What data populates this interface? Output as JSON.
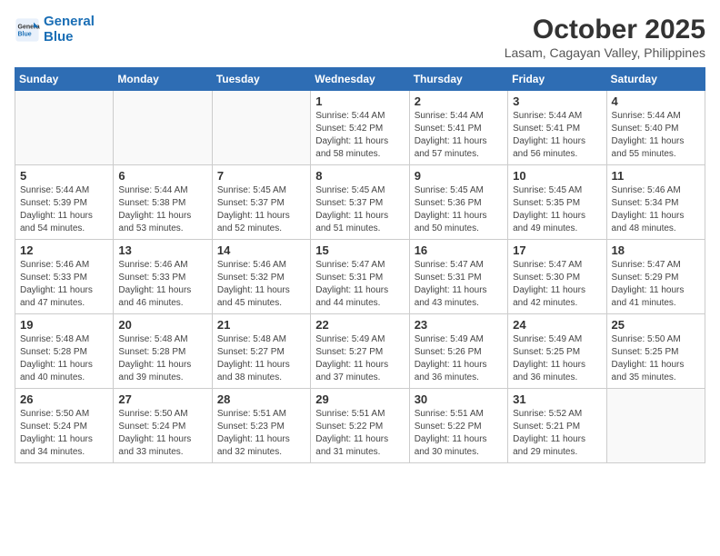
{
  "logo": {
    "line1": "General",
    "line2": "Blue"
  },
  "title": "October 2025",
  "subtitle": "Lasam, Cagayan Valley, Philippines",
  "days_of_week": [
    "Sunday",
    "Monday",
    "Tuesday",
    "Wednesday",
    "Thursday",
    "Friday",
    "Saturday"
  ],
  "weeks": [
    [
      {
        "day": "",
        "info": ""
      },
      {
        "day": "",
        "info": ""
      },
      {
        "day": "",
        "info": ""
      },
      {
        "day": "1",
        "info": "Sunrise: 5:44 AM\nSunset: 5:42 PM\nDaylight: 11 hours\nand 58 minutes."
      },
      {
        "day": "2",
        "info": "Sunrise: 5:44 AM\nSunset: 5:41 PM\nDaylight: 11 hours\nand 57 minutes."
      },
      {
        "day": "3",
        "info": "Sunrise: 5:44 AM\nSunset: 5:41 PM\nDaylight: 11 hours\nand 56 minutes."
      },
      {
        "day": "4",
        "info": "Sunrise: 5:44 AM\nSunset: 5:40 PM\nDaylight: 11 hours\nand 55 minutes."
      }
    ],
    [
      {
        "day": "5",
        "info": "Sunrise: 5:44 AM\nSunset: 5:39 PM\nDaylight: 11 hours\nand 54 minutes."
      },
      {
        "day": "6",
        "info": "Sunrise: 5:44 AM\nSunset: 5:38 PM\nDaylight: 11 hours\nand 53 minutes."
      },
      {
        "day": "7",
        "info": "Sunrise: 5:45 AM\nSunset: 5:37 PM\nDaylight: 11 hours\nand 52 minutes."
      },
      {
        "day": "8",
        "info": "Sunrise: 5:45 AM\nSunset: 5:37 PM\nDaylight: 11 hours\nand 51 minutes."
      },
      {
        "day": "9",
        "info": "Sunrise: 5:45 AM\nSunset: 5:36 PM\nDaylight: 11 hours\nand 50 minutes."
      },
      {
        "day": "10",
        "info": "Sunrise: 5:45 AM\nSunset: 5:35 PM\nDaylight: 11 hours\nand 49 minutes."
      },
      {
        "day": "11",
        "info": "Sunrise: 5:46 AM\nSunset: 5:34 PM\nDaylight: 11 hours\nand 48 minutes."
      }
    ],
    [
      {
        "day": "12",
        "info": "Sunrise: 5:46 AM\nSunset: 5:33 PM\nDaylight: 11 hours\nand 47 minutes."
      },
      {
        "day": "13",
        "info": "Sunrise: 5:46 AM\nSunset: 5:33 PM\nDaylight: 11 hours\nand 46 minutes."
      },
      {
        "day": "14",
        "info": "Sunrise: 5:46 AM\nSunset: 5:32 PM\nDaylight: 11 hours\nand 45 minutes."
      },
      {
        "day": "15",
        "info": "Sunrise: 5:47 AM\nSunset: 5:31 PM\nDaylight: 11 hours\nand 44 minutes."
      },
      {
        "day": "16",
        "info": "Sunrise: 5:47 AM\nSunset: 5:31 PM\nDaylight: 11 hours\nand 43 minutes."
      },
      {
        "day": "17",
        "info": "Sunrise: 5:47 AM\nSunset: 5:30 PM\nDaylight: 11 hours\nand 42 minutes."
      },
      {
        "day": "18",
        "info": "Sunrise: 5:47 AM\nSunset: 5:29 PM\nDaylight: 11 hours\nand 41 minutes."
      }
    ],
    [
      {
        "day": "19",
        "info": "Sunrise: 5:48 AM\nSunset: 5:28 PM\nDaylight: 11 hours\nand 40 minutes."
      },
      {
        "day": "20",
        "info": "Sunrise: 5:48 AM\nSunset: 5:28 PM\nDaylight: 11 hours\nand 39 minutes."
      },
      {
        "day": "21",
        "info": "Sunrise: 5:48 AM\nSunset: 5:27 PM\nDaylight: 11 hours\nand 38 minutes."
      },
      {
        "day": "22",
        "info": "Sunrise: 5:49 AM\nSunset: 5:27 PM\nDaylight: 11 hours\nand 37 minutes."
      },
      {
        "day": "23",
        "info": "Sunrise: 5:49 AM\nSunset: 5:26 PM\nDaylight: 11 hours\nand 36 minutes."
      },
      {
        "day": "24",
        "info": "Sunrise: 5:49 AM\nSunset: 5:25 PM\nDaylight: 11 hours\nand 36 minutes."
      },
      {
        "day": "25",
        "info": "Sunrise: 5:50 AM\nSunset: 5:25 PM\nDaylight: 11 hours\nand 35 minutes."
      }
    ],
    [
      {
        "day": "26",
        "info": "Sunrise: 5:50 AM\nSunset: 5:24 PM\nDaylight: 11 hours\nand 34 minutes."
      },
      {
        "day": "27",
        "info": "Sunrise: 5:50 AM\nSunset: 5:24 PM\nDaylight: 11 hours\nand 33 minutes."
      },
      {
        "day": "28",
        "info": "Sunrise: 5:51 AM\nSunset: 5:23 PM\nDaylight: 11 hours\nand 32 minutes."
      },
      {
        "day": "29",
        "info": "Sunrise: 5:51 AM\nSunset: 5:22 PM\nDaylight: 11 hours\nand 31 minutes."
      },
      {
        "day": "30",
        "info": "Sunrise: 5:51 AM\nSunset: 5:22 PM\nDaylight: 11 hours\nand 30 minutes."
      },
      {
        "day": "31",
        "info": "Sunrise: 5:52 AM\nSunset: 5:21 PM\nDaylight: 11 hours\nand 29 minutes."
      },
      {
        "day": "",
        "info": ""
      }
    ]
  ]
}
